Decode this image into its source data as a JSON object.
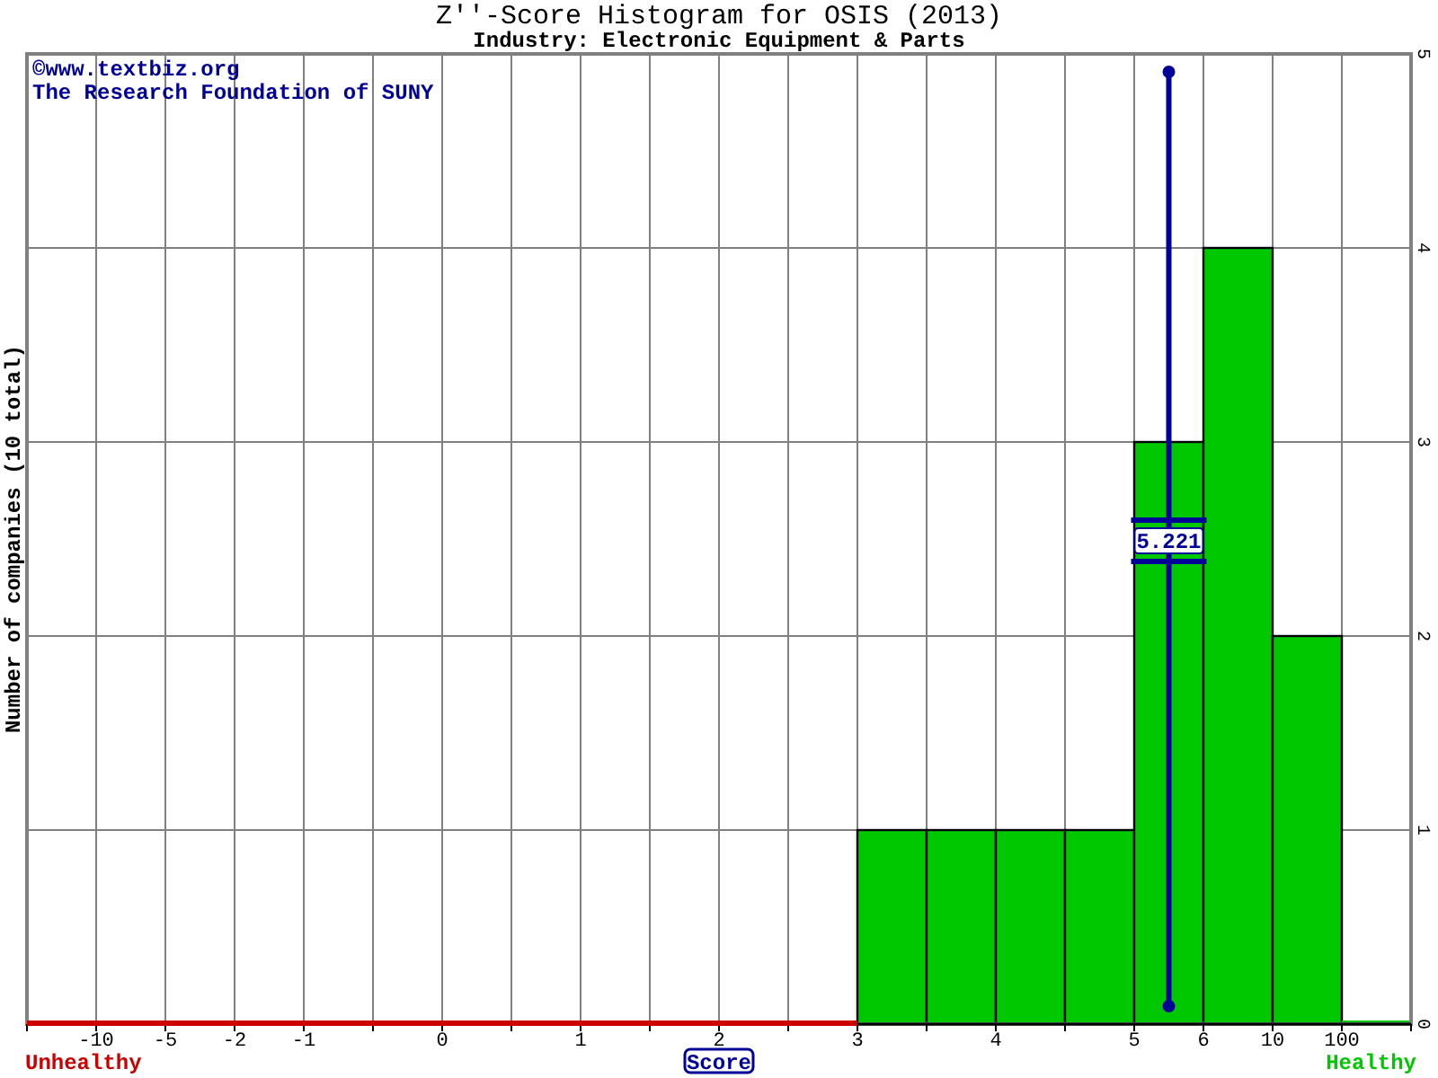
{
  "chart": {
    "subtitle": "Industry: Electronic Equipment & Parts",
    "credits": [
      "©www.textbiz.org",
      "The Research Foundation of SUNY"
    ],
    "unhealthy_label": "Unhealthy",
    "healthy_label": "Healthy",
    "score_marker": {
      "label": "5.221"
    },
    "chart_data": {
      "type": "bar",
      "title": "Z''-Score Histogram for OSIS (2013)",
      "xlabel": "Score",
      "ylabel": "Number of companies (10 total)",
      "categories": [
        null,
        "-10",
        "-5",
        "-2",
        "-1",
        null,
        "0",
        null,
        "1",
        null,
        "2",
        null,
        "3",
        null,
        "4",
        null,
        "5",
        "6",
        "10",
        "100"
      ],
      "series": [
        {
          "color": "#00c800",
          "values": [
            null,
            null,
            null,
            null,
            null,
            null,
            null,
            null,
            null,
            null,
            null,
            null,
            1,
            1,
            1,
            1,
            3,
            4,
            2,
            0
          ]
        }
      ],
      "ylim": [
        0,
        5
      ],
      "yticks": [
        0,
        1,
        2,
        3,
        4,
        5
      ],
      "grid": true
    }
  }
}
